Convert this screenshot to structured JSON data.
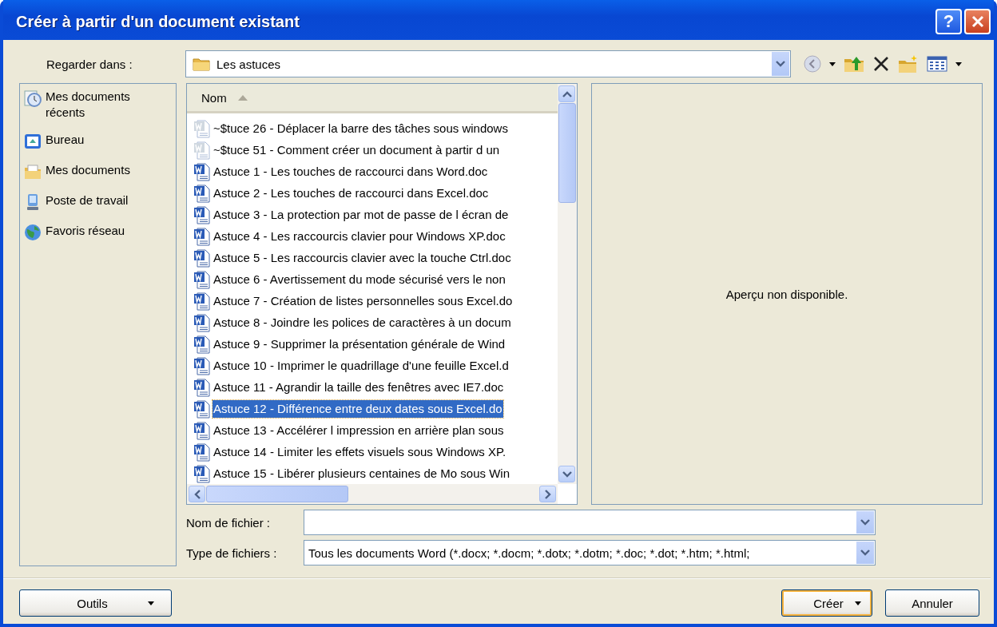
{
  "window": {
    "title": "Créer à partir d'un document existant",
    "buttons": [
      {
        "kind": "help",
        "label": "?"
      }
    ]
  },
  "look_in": {
    "label": "Regarder dans :",
    "value": "Les astuces"
  },
  "places": [
    {
      "kind": "recent",
      "label": "Mes documents récents"
    },
    {
      "kind": "desktop",
      "label": "Bureau"
    },
    {
      "kind": "documents",
      "label": "Mes documents"
    },
    {
      "kind": "computer",
      "label": "Poste de travail"
    },
    {
      "kind": "network",
      "label": "Favoris réseau"
    }
  ],
  "file_list": {
    "column": "Nom",
    "files": [
      {
        "kind": "temp",
        "name": "~$tuce 26 - Déplacer la barre des tâches sous windows",
        "selected": false
      },
      {
        "kind": "temp",
        "name": "~$tuce 51 - Comment créer un document à partir d un",
        "selected": false
      },
      {
        "kind": "doc",
        "name": "Astuce 1 - Les touches de raccourci dans Word.doc",
        "selected": false
      },
      {
        "kind": "doc",
        "name": "Astuce 2 - Les touches de raccourci dans Excel.doc",
        "selected": false
      },
      {
        "kind": "doc",
        "name": "Astuce 3 - La protection par mot de passe de l écran de",
        "selected": false
      },
      {
        "kind": "doc",
        "name": "Astuce 4 - Les raccourcis clavier pour Windows XP.doc",
        "selected": false
      },
      {
        "kind": "doc",
        "name": "Astuce 5 - Les raccourcis clavier avec la touche Ctrl.doc",
        "selected": false
      },
      {
        "kind": "doc",
        "name": "Astuce 6 - Avertissement du mode sécurisé vers le non",
        "selected": false
      },
      {
        "kind": "doc",
        "name": "Astuce 7 - Création de listes personnelles sous Excel.do",
        "selected": false
      },
      {
        "kind": "doc",
        "name": "Astuce 8 - Joindre les polices de caractères à un docum",
        "selected": false
      },
      {
        "kind": "doc",
        "name": "Astuce 9 - Supprimer la présentation générale de Wind",
        "selected": false
      },
      {
        "kind": "doc",
        "name": "Astuce 10 - Imprimer le quadrillage d'une feuille Excel.d",
        "selected": false
      },
      {
        "kind": "doc",
        "name": "Astuce 11 - Agrandir la taille des fenêtres avec IE7.doc",
        "selected": false
      },
      {
        "kind": "doc",
        "name": "Astuce 12 - Différence entre deux dates sous Excel.do",
        "selected": true
      },
      {
        "kind": "doc",
        "name": "Astuce 13 - Accélérer l impression en arrière plan sous",
        "selected": false
      },
      {
        "kind": "doc",
        "name": "Astuce 14 - Limiter les effets visuels sous Windows XP.",
        "selected": false
      },
      {
        "kind": "doc",
        "name": "Astuce 15 - Libérer plusieurs centaines de Mo sous Win",
        "selected": false
      }
    ]
  },
  "preview": {
    "message": "Aperçu non disponible."
  },
  "file_name": {
    "label": "Nom de fichier :"
  },
  "file_type": {
    "label": "Type de fichiers :",
    "value": "Tous les documents Word (*.docx; *.docm; *.dotx; *.dotm; *.doc; *.dot; *.htm; *.html;"
  },
  "buttons": {
    "tools": "Outils",
    "create": "Créer",
    "cancel": "Annuler"
  }
}
